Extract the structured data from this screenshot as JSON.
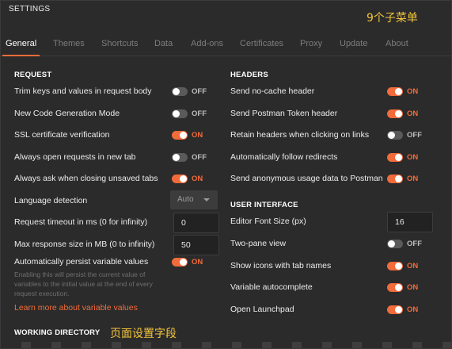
{
  "window": {
    "title": "SETTINGS"
  },
  "annotations": {
    "top": "9个子菜单",
    "bottom": "页面设置字段"
  },
  "tabs": [
    "General",
    "Themes",
    "Shortcuts",
    "Data",
    "Add-ons",
    "Certificates",
    "Proxy",
    "Update",
    "About"
  ],
  "active_tab": "General",
  "request": {
    "heading": "REQUEST",
    "trim_keys": {
      "label": "Trim keys and values in request body",
      "state": "OFF"
    },
    "new_codegen": {
      "label": "New Code Generation Mode",
      "state": "OFF"
    },
    "ssl_verify": {
      "label": "SSL certificate verification",
      "state": "ON"
    },
    "open_new_tab": {
      "label": "Always open requests in new tab",
      "state": "OFF"
    },
    "ask_closing": {
      "label": "Always ask when closing unsaved tabs",
      "state": "ON"
    },
    "language_detection": {
      "label": "Language detection",
      "value": "Auto"
    },
    "timeout": {
      "label": "Request timeout in ms (0 for infinity)",
      "value": "0"
    },
    "max_response": {
      "label": "Max response size in MB (0 to infinity)",
      "value": "50"
    },
    "persist_vars": {
      "label": "Automatically persist variable values",
      "state": "ON",
      "help": "Enabling this will persist the current value of variables to the initial value at the end of every request execution.",
      "link": "Learn more about variable values"
    }
  },
  "working_directory": {
    "heading": "WORKING DIRECTORY"
  },
  "headers": {
    "heading": "HEADERS",
    "no_cache": {
      "label": "Send no-cache header",
      "state": "ON"
    },
    "postman_token": {
      "label": "Send Postman Token header",
      "state": "ON"
    },
    "retain_headers": {
      "label": "Retain headers when clicking on links",
      "state": "OFF"
    },
    "follow_redirects": {
      "label": "Automatically follow redirects",
      "state": "ON"
    },
    "anon_usage": {
      "label": "Send anonymous usage data to Postman",
      "state": "ON"
    }
  },
  "user_interface": {
    "heading": "USER INTERFACE",
    "font_size": {
      "label": "Editor Font Size (px)",
      "value": "16"
    },
    "two_pane": {
      "label": "Two-pane view",
      "state": "OFF"
    },
    "icons_tab_names": {
      "label": "Show icons with tab names",
      "state": "ON"
    },
    "var_autocomplete": {
      "label": "Variable autocomplete",
      "state": "ON"
    },
    "open_launchpad": {
      "label": "Open Launchpad",
      "state": "ON"
    }
  },
  "colors": {
    "accent": "#f26b3a",
    "annotation": "#f3c43c",
    "background": "#2b2b2b"
  }
}
